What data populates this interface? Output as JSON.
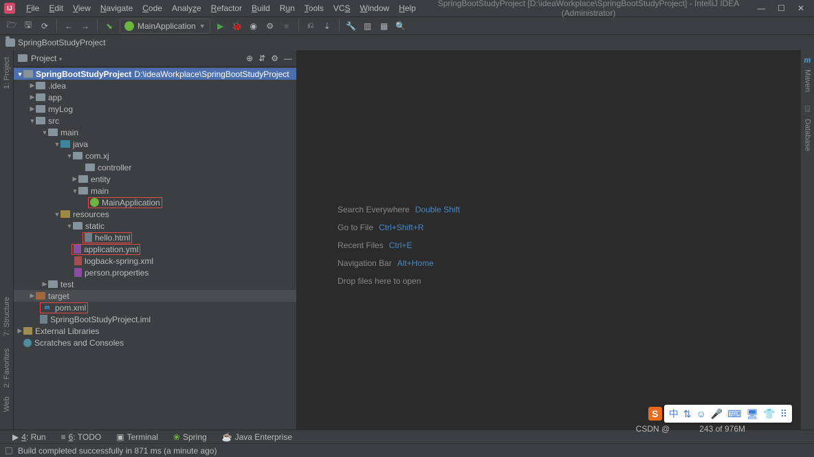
{
  "title": "SpringBootStudyProject [D:\\ideaWorkplace\\SpringBootStudyProject] - IntelliJ IDEA (Administrator)",
  "menu": [
    "File",
    "Edit",
    "View",
    "Navigate",
    "Code",
    "Analyze",
    "Refactor",
    "Build",
    "Run",
    "Tools",
    "VCS",
    "Window",
    "Help"
  ],
  "runConfig": "MainApplication",
  "breadcrumb": "SpringBootStudyProject",
  "panel": {
    "title": "Project",
    "dropdown": "▾"
  },
  "tree": {
    "root": "SpringBootStudyProject",
    "rootPath": "D:\\ideaWorkplace\\SpringBootStudyProject",
    "idea": ".idea",
    "app": "app",
    "myLog": "myLog",
    "src": "src",
    "main": "main",
    "java": "java",
    "comxj": "com.xj",
    "controller": "controller",
    "entity": "entity",
    "mainpkg": "main",
    "mainApp": "MainApplication",
    "resources": "resources",
    "static": "static",
    "hello": "hello.html",
    "appyml": "application.yml",
    "logback": "logback-spring.xml",
    "person": "person.properties",
    "test": "test",
    "target": "target",
    "pom": "pom.xml",
    "iml": "SpringBootStudyProject.iml",
    "extlib": "External Libraries",
    "scratches": "Scratches and Consoles"
  },
  "welcome": {
    "search": {
      "label": "Search Everywhere",
      "key": "Double Shift"
    },
    "goto": {
      "label": "Go to File",
      "key": "Ctrl+Shift+R"
    },
    "recent": {
      "label": "Recent Files",
      "key": "Ctrl+E"
    },
    "navbar": {
      "label": "Navigation Bar",
      "key": "Alt+Home"
    },
    "drop": {
      "label": "Drop files here to open"
    }
  },
  "leftGutter": [
    "1: Project",
    "7: Structure",
    "2: Favorites",
    "Web"
  ],
  "rightGutter": [
    "Maven",
    "Database"
  ],
  "bottomTabs": [
    {
      "icon": "▶",
      "label": "4: Run"
    },
    {
      "icon": "≡",
      "label": "6: TODO"
    },
    {
      "icon": "▣",
      "label": "Terminal"
    },
    {
      "icon": "❀",
      "label": "Spring"
    },
    {
      "icon": "☕",
      "label": "Java Enterprise"
    }
  ],
  "status": "Build completed successfully in 871 ms (a minute ago)",
  "memory": "243 of 976M",
  "watermark": "CSDN @",
  "floatingIcons": [
    "中",
    "⇅",
    "☺",
    "🎤",
    "⌨",
    "🖥",
    "👕",
    "⠿"
  ]
}
